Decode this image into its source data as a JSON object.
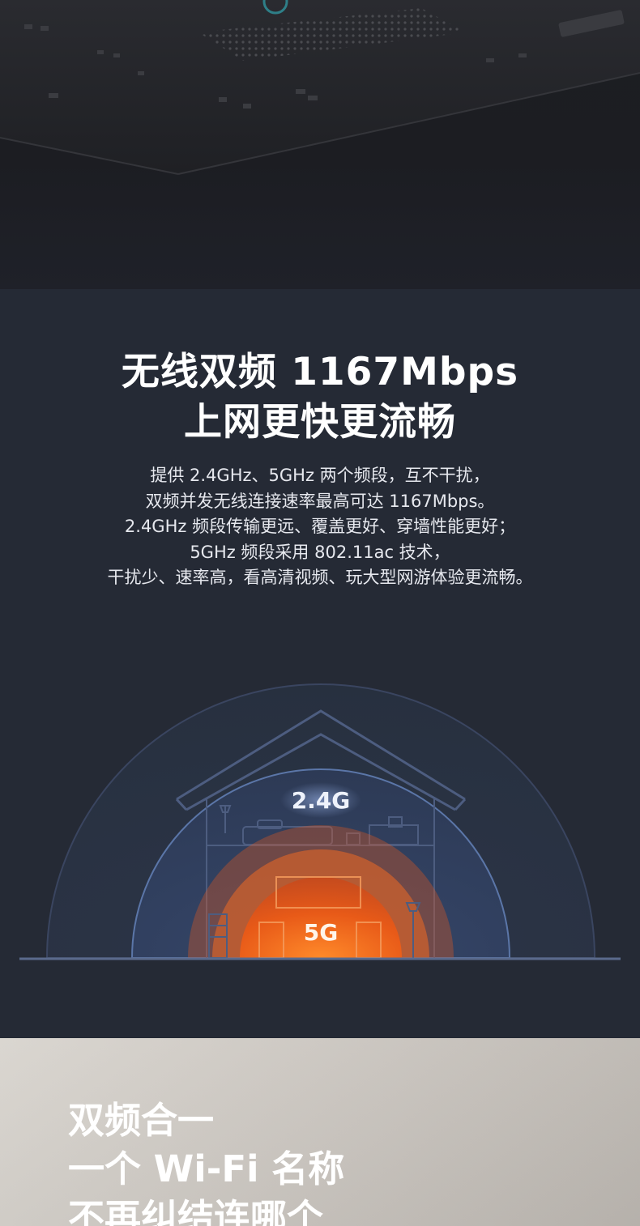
{
  "section_speed": {
    "title_line1": "无线双频 1167Mbps",
    "title_line2": "上网更快更流畅",
    "description": [
      "提供 2.4GHz、5GHz 两个频段，互不干扰，",
      "双频并发无线连接速率最高可达 1167Mbps。",
      "2.4GHz 频段传输更远、覆盖更好、穿墙性能更好；",
      "5GHz 频段采用 802.11ac 技术，",
      "干扰少、速率高，看高清视频、玩大型网游体验更流畅。"
    ],
    "band_24_label": "2.4G",
    "band_5_label": "5G",
    "colors": {
      "bg": "#252a35",
      "band24": "#3a5277",
      "band5": "#f06a1a"
    }
  },
  "section_single_ssid": {
    "title_lines": [
      "双频合一",
      "一个 Wi-Fi 名称",
      "不再纠结连哪个"
    ]
  }
}
